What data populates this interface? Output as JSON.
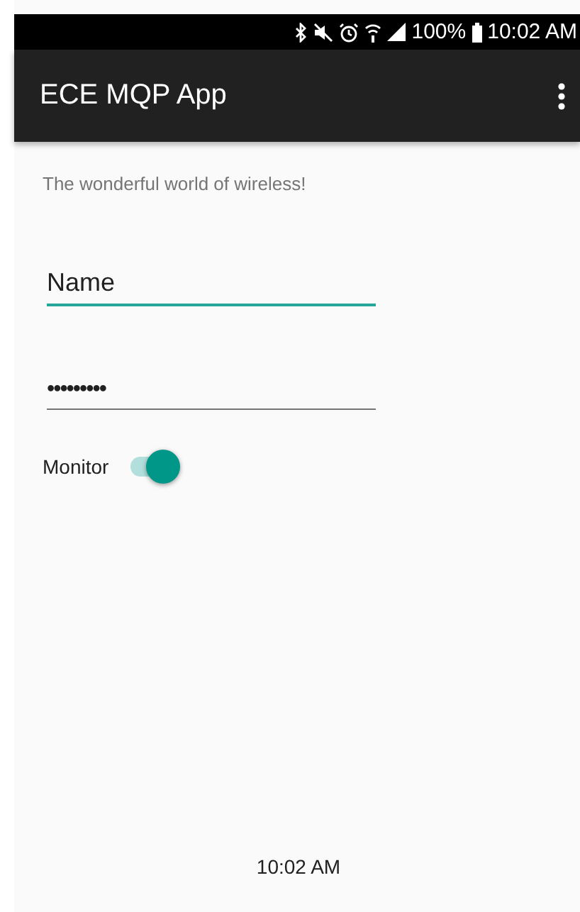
{
  "status_bar": {
    "battery": "100%",
    "time": "10:02 AM"
  },
  "app_bar": {
    "title": "ECE MQP App"
  },
  "subtitle": "The wonderful world of wireless!",
  "fields": [
    {
      "kind": "text",
      "value": "Name",
      "focused": true
    },
    {
      "kind": "password",
      "value": "•••••••••",
      "focused": false
    }
  ],
  "switch": {
    "label": "Monitor",
    "on": true
  },
  "clock": "10:02 AM"
}
